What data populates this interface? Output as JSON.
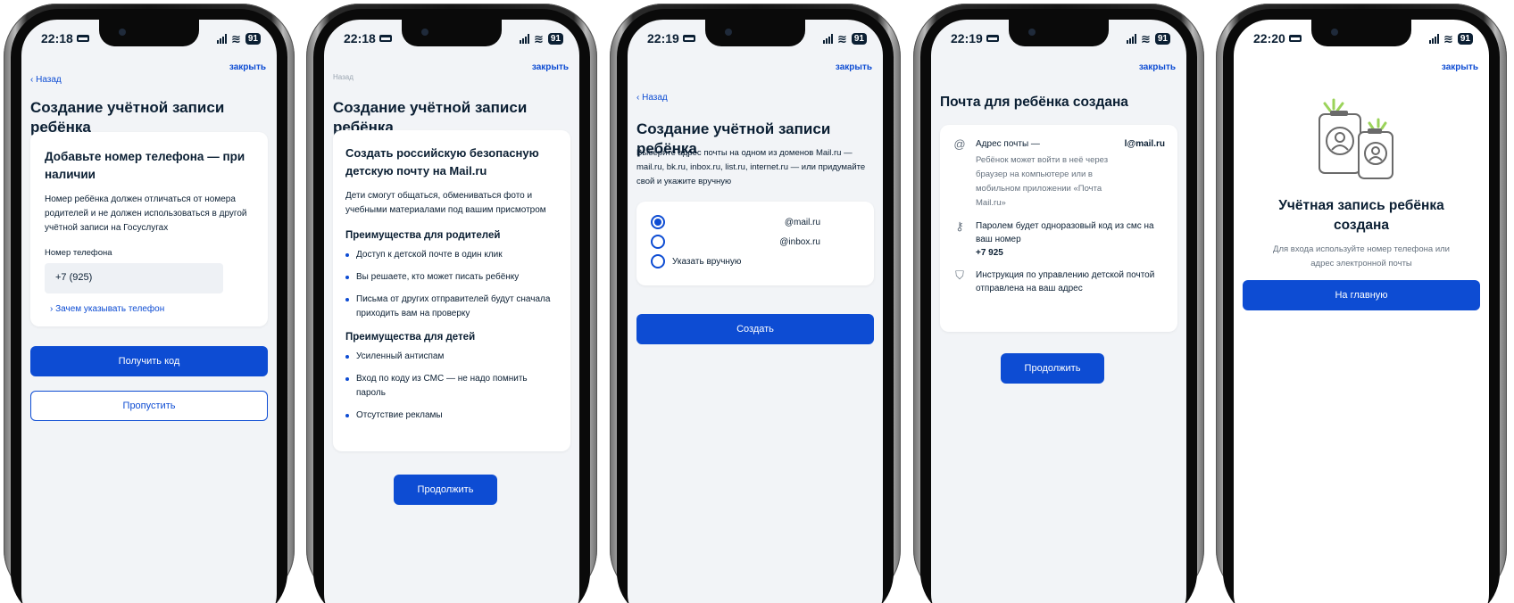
{
  "status": {
    "battery": "91",
    "times": [
      "22:18",
      "22:18",
      "22:19",
      "22:19",
      "22:20"
    ]
  },
  "common": {
    "close_label": "закрыть",
    "back_label": "‹ Назад"
  },
  "screen1": {
    "back_label": "‹ Назад",
    "title": "Создание учётной записи ребёнка",
    "card_heading": "Добавьте номер телефона — при наличии",
    "card_text": "Номер ребёнка должен отличаться от номера родителей и не должен использоваться в другой учётной записи на Госуслугах",
    "phone_label": "Номер телефона",
    "phone_value": "+7 (925)",
    "why_link": "› Зачем указывать телефон",
    "get_code_button": "Получить код",
    "skip_button": "Пропустить"
  },
  "screen2": {
    "back_label": "Назад",
    "title": "Создание учётной записи ребёнка",
    "card_heading": "Создать российскую безопасную детскую почту на Mail.ru",
    "card_text": "Дети смогут общаться, обмениваться фото и учебными материалами под вашим присмотром",
    "parents_heading": "Преимущества для родителей",
    "parents_items": [
      "Доступ к детской почте в один клик",
      "Вы решаете, кто может писать ребёнку",
      "Письма от других отправителей будут сначала приходить вам на проверку"
    ],
    "kids_heading": "Преимущества для детей",
    "kids_items": [
      "Усиленный антиспам",
      "Вход по коду из СМС — не надо помнить пароль",
      "Отсутствие рекламы"
    ],
    "continue_button": "Продолжить"
  },
  "screen3": {
    "back_label": "‹ Назад",
    "title": "Создание учётной записи ребёнка",
    "description": "Выберите адрес почты на одном из доменов Mail.ru — mail.ru, bk.ru, inbox.ru, list.ru, internet.ru — или придумайте свой и укажите вручную",
    "options": [
      {
        "label": "@mail.ru",
        "selected": true
      },
      {
        "label": "@inbox.ru",
        "selected": false
      },
      {
        "label": "Указать вручную",
        "selected": false
      }
    ],
    "create_button": "Создать"
  },
  "screen4": {
    "title": "Почта для ребёнка создана",
    "email_label": "Адрес почты —",
    "email_value": "l@mail.ru",
    "email_note": "Ребёнок может войти в неё через браузер на компьютере или в мобильном приложении «Почта Mail.ru»",
    "password_text": "Паролем будет одноразовый код из смс на ваш номер",
    "password_number": "+7 925",
    "instruction_text": "Инструкция по управлению детской почтой отправлена на ваш адрес",
    "continue_button": "Продолжить",
    "icons": {
      "email": "at-icon",
      "password": "key-icon",
      "instruction": "shield-icon"
    }
  },
  "screen5": {
    "title": "Учётная запись ребёнка создана",
    "subtitle": "Для входа используйте номер телефона или адрес электронной почты",
    "home_button": "На главную"
  },
  "colors": {
    "accent": "#0d4cd3",
    "screen_bg": "#f2f4f7",
    "text": "#0b1f33",
    "muted": "#66727f",
    "check_green": "#9bd35a"
  }
}
